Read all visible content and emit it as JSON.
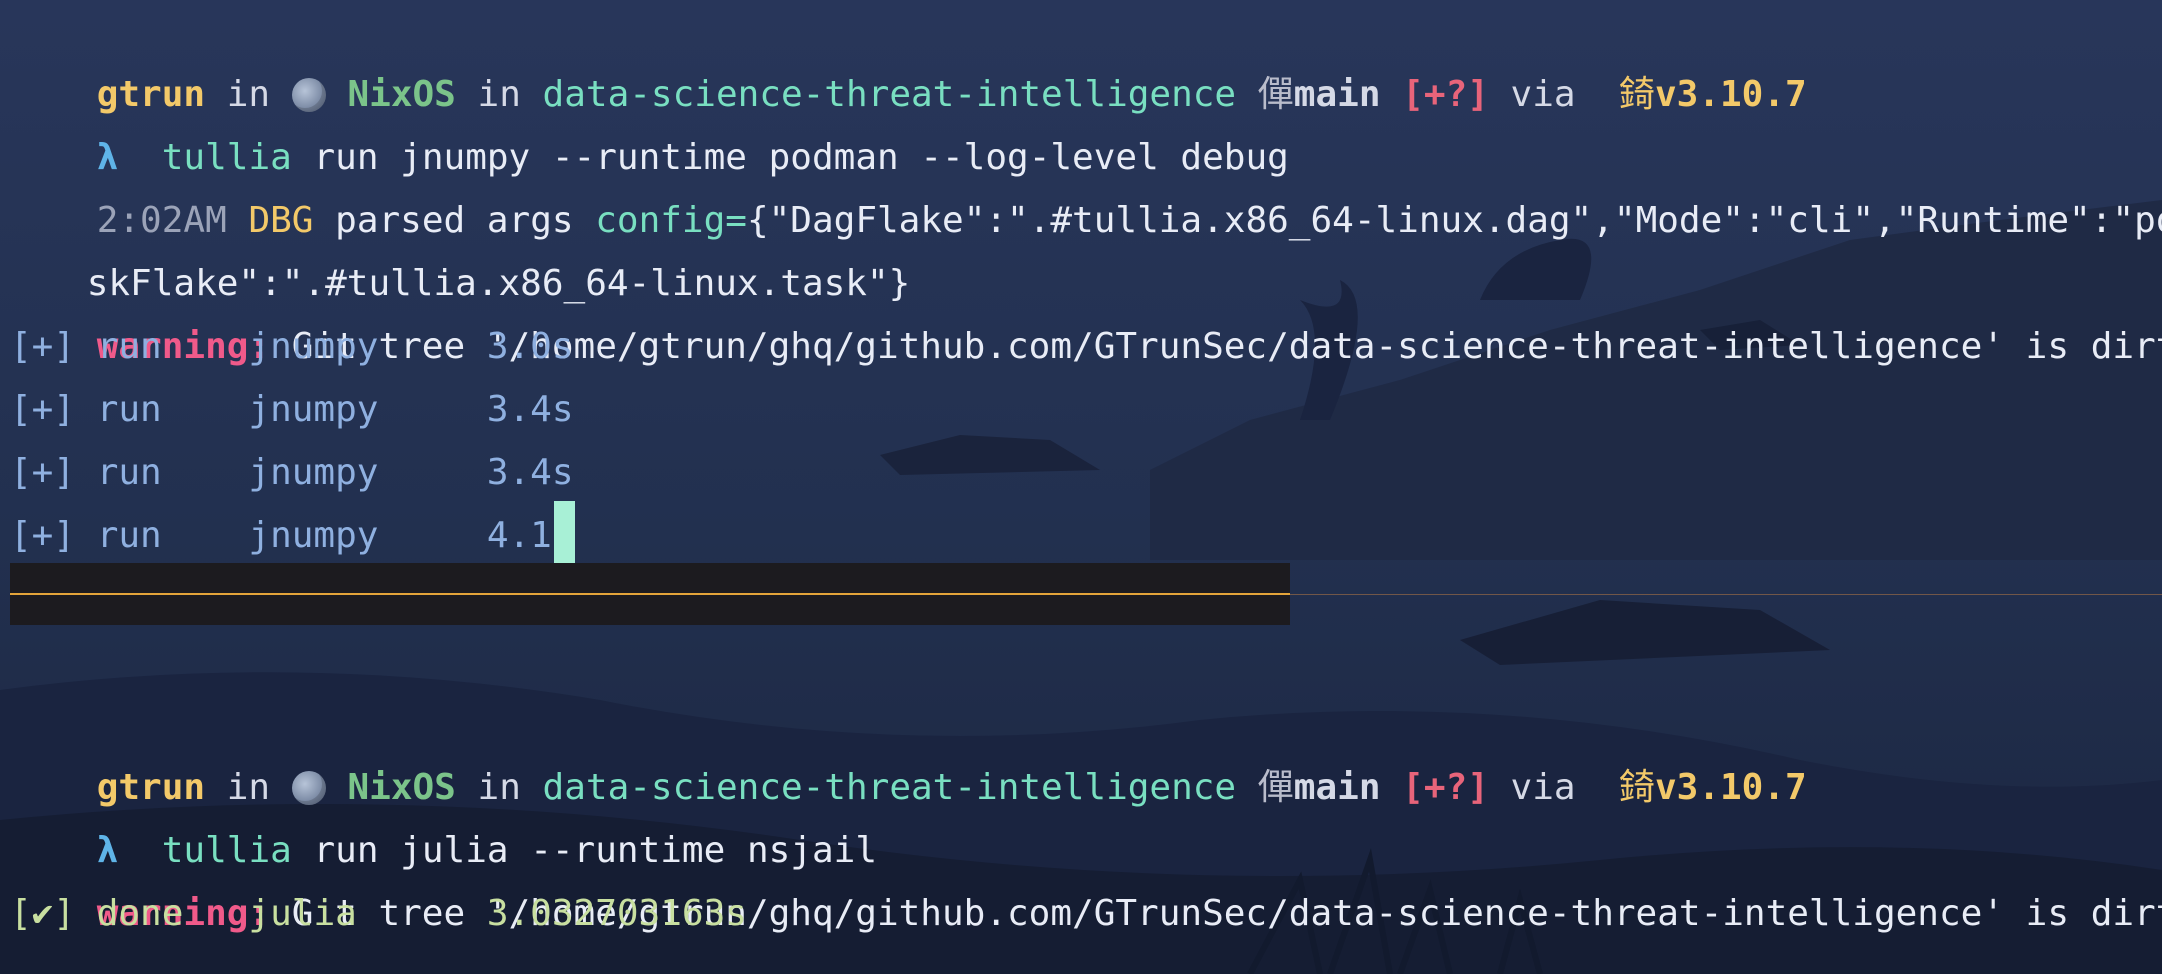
{
  "prompt1": {
    "user": "gtrun",
    "in1": " in ",
    "os": "NixOS",
    "in2": " in ",
    "dir": "data-science-threat-intelligence",
    "branch_icon": " 僤",
    "branch": "main",
    "git_status": " [+?]",
    "via": " via ",
    "py_icon": " 錡",
    "py_version": "v3.10.7"
  },
  "cmd1": {
    "symbol": "λ",
    "tool": "tullia",
    "args": " run jnumpy --runtime podman --log-level debug"
  },
  "log1": {
    "time": "2:02AM",
    "level": "DBG",
    "msg": " parsed args ",
    "key": "config=",
    "value": "{\"DagFlake\":\".#tullia.x86_64-linux.dag\",\"Mode\":\"cli\",\"Runtime\":\"podman\",\"",
    "wrap": "skFlake\":\".#tullia.x86_64-linux.task\"}"
  },
  "warning1": {
    "label": "warning:",
    "text": " Git tree '/home/gtrun/ghq/github.com/GTrunSec/data-science-threat-intelligence' is dirty"
  },
  "progress": [
    "[+] run    jnumpy     3.0s",
    "[+] run    jnumpy     3.4s",
    "[+] run    jnumpy     3.4s",
    "[+] run    jnumpy     4.1s"
  ],
  "prompt2": {
    "user": "gtrun",
    "in1": " in ",
    "os": "NixOS",
    "in2": " in ",
    "dir": "data-science-threat-intelligence",
    "branch_icon": " 僤",
    "branch": "main",
    "git_status": " [+?]",
    "via": " via ",
    "py_icon": " 錡",
    "py_version": "v3.10.7"
  },
  "cmd2": {
    "symbol": "λ",
    "tool": "tullia",
    "args": " run julia --runtime nsjail"
  },
  "warning2": {
    "label": "warning:",
    "text": " Git tree '/home/gtrun/ghq/github.com/GTrunSec/data-science-threat-intelligence' is dirty"
  },
  "result": "[✔] done   julia      3.032703163s",
  "colors": {
    "background": "#1e2a44",
    "user": "#f3c969",
    "os": "#7bc48a",
    "dir": "#79dfc1",
    "warning": "#f05a8a",
    "progress": "#8fb0e0",
    "done": "#c8dfa0",
    "cursor": "#a8f0d6",
    "status_rule": "#e3a43a"
  }
}
